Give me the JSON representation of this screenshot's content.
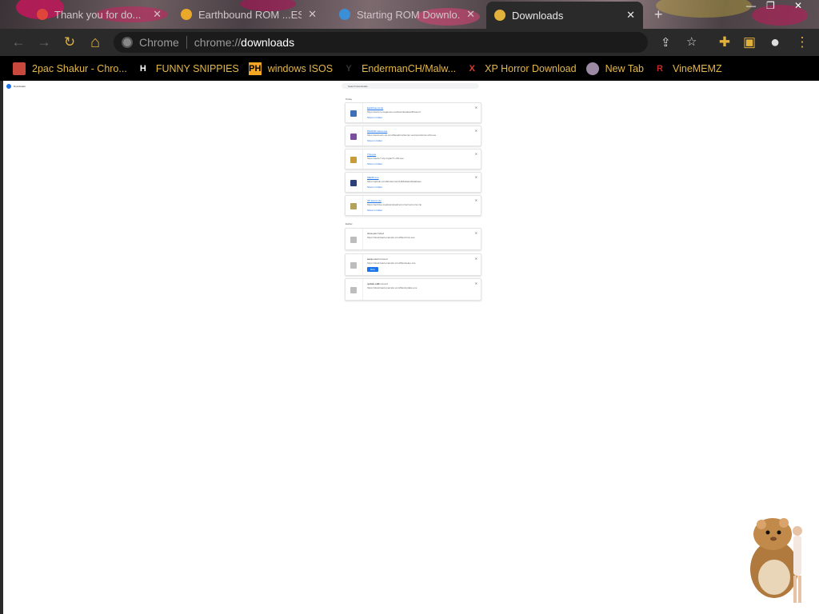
{
  "tabs": [
    {
      "title": "Thank you for do...",
      "favicon_color": "#e0453b",
      "active": false
    },
    {
      "title": "Earthbound ROM ...ES",
      "favicon_color": "#e8a82a",
      "active": false
    },
    {
      "title": "Starting ROM Downlo...",
      "favicon_color": "#3b8fd6",
      "active": false
    },
    {
      "title": "Downloads",
      "favicon_color": "#e2b13c",
      "active": true
    }
  ],
  "tab_close_glyph": "✕",
  "new_tab_glyph": "+",
  "window_controls": {
    "minimize": "—",
    "restore": "❐",
    "close": "✕"
  },
  "toolbar": {
    "back_glyph": "←",
    "forward_glyph": "→",
    "reload_glyph": "↻",
    "home_glyph": "⌂",
    "omnibox_site": "Chrome",
    "omnibox_scheme": "chrome://",
    "omnibox_host": "downloads",
    "share_glyph": "⇪",
    "star_glyph": "☆",
    "extensions_glyph": "✚",
    "sidepanel_glyph": "▣",
    "profile_glyph": "●",
    "menu_glyph": "⋮"
  },
  "bookmarks": [
    {
      "label": "2pac Shakur - Chro...",
      "icon_text": "",
      "icon_color": "#c9483e",
      "icon": "bookmark-page-icon"
    },
    {
      "label": "FUNNY SNIPPIES",
      "icon_text": "H",
      "icon_color": "#ffffff",
      "icon": "h-logo-icon"
    },
    {
      "label": "windows ISOS",
      "icon_text": "PH",
      "icon_color": "#f5a623",
      "icon": "ph-logo-icon"
    },
    {
      "label": "EndermanCH/Malw...",
      "icon_text": "Y",
      "icon_color": "#333333",
      "icon": "github-icon"
    },
    {
      "label": "XP Horror Download",
      "icon_text": "X",
      "icon_color": "#e53935",
      "icon": "x-logo-icon"
    },
    {
      "label": "New Tab",
      "icon_text": "",
      "icon_color": "#9c8aa5",
      "icon": "chrome-globe-icon"
    },
    {
      "label": "VineMEMZ",
      "icon_text": "R",
      "icon_color": "#c62828",
      "icon": "r-logo-icon"
    }
  ],
  "downloads_page": {
    "title": "Downloads",
    "search_placeholder": "Search downloads",
    "sections": [
      "Today",
      "Earlier"
    ],
    "items": [
      {
        "name": "Earthbound.zip",
        "url": "https://www.romsgames.net/download/earthbound",
        "action": "Show in folder",
        "icon_color": "#3e6fb8",
        "status": ""
      },
      {
        "name": "WinRAR setup.exe",
        "url": "https://www.win-rar.com/fileadmin/winrar-versions/winrar-x64.exe",
        "action": "Show in folder",
        "icon_color": "#7b4ea0",
        "status": ""
      },
      {
        "name": "7zip.exe",
        "url": "https://www.7-zip.org/a/7z-x64.exe",
        "action": "Show in folder",
        "icon_color": "#c79a3a",
        "status": ""
      },
      {
        "name": "MEMZ.exe",
        "url": "https://github.com/EndermanCH/MalwareDatabase",
        "action": "Show in folder",
        "icon_color": "#2b3f7a",
        "status": ""
      },
      {
        "name": "XP Horror.zip",
        "url": "https://archive.org/download/xp-horror/xp-horror.zip",
        "action": "Show in folder",
        "icon_color": "#b5a25a",
        "status": ""
      },
      {
        "name": "virus.exe",
        "url": "https://download.example.com/files/virus.exe",
        "action": "",
        "icon_color": "#bdbdbd",
        "status": "Failed"
      },
      {
        "name": "setup.exe",
        "url": "https://download.example.com/files/setup.exe",
        "action": "Retry",
        "icon_color": "#bdbdbd",
        "status": "Canceled"
      },
      {
        "name": "update.exe",
        "url": "https://download.example.com/files/update.exe",
        "action": "",
        "icon_color": "#bdbdbd",
        "status": "Removed"
      }
    ],
    "dismiss_glyph": "✕"
  }
}
